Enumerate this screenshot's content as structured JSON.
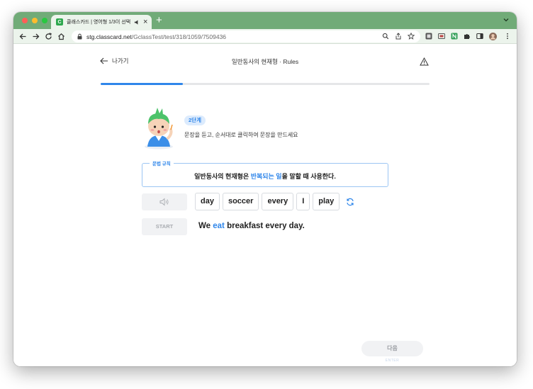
{
  "browser": {
    "tab": {
      "favicon_text": "C",
      "title": "클래스카드 | 영어형 1/3이 선택 ..."
    },
    "new_tab": "+",
    "tab_close": "×",
    "url": {
      "domain": "stg.classcard.net",
      "path": "/GclassTest/test/318/1059/7509436"
    },
    "icons": {
      "back": "arrow-left-icon",
      "forward": "arrow-right-icon",
      "reload": "reload-icon",
      "home": "home-icon",
      "lock": "lock-icon",
      "zoom": "magnifier-icon",
      "share": "share-icon",
      "bookmark": "star-icon",
      "extensions": [
        "extension-square-icon",
        "extension-cast-icon",
        "extension-n-icon",
        "puzzle-icon",
        "sidepanel-icon",
        "profile-avatar"
      ],
      "menu": "kebab-menu-icon"
    },
    "colors": {
      "tab_strip": "#71ab78",
      "toolbar": "#ecf4ec"
    }
  },
  "page": {
    "back_label": "나가기",
    "title": "일반동사의 현재형 · Rules",
    "progress_fraction": 0.25,
    "step_badge": "2단계",
    "instruction": "문장을 듣고, 순서대로 클릭하여 문장을 만드세요",
    "rule": {
      "tag": "문법 규칙",
      "text_before": "일반동사의 현재형은 ",
      "text_highlight": "반복되는 일",
      "text_after": "을 말할 때 사용한다."
    },
    "word_chips": [
      "day",
      "soccer",
      "every",
      "I",
      "play"
    ],
    "start_label": "START",
    "sentence": {
      "before": "We ",
      "highlight": "eat",
      "after": " breakfast every day."
    },
    "next_label": "다음",
    "next_hint": "ENTER",
    "colors": {
      "accent": "#2f86ea",
      "progress_track": "#e5e6e8",
      "button_bg": "#f1f2f4"
    }
  }
}
